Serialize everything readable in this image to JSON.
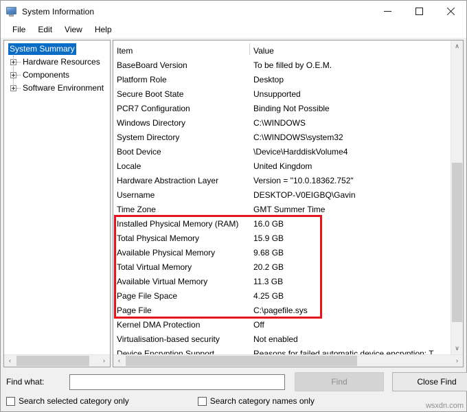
{
  "window": {
    "title": "System Information",
    "icon": "monitor-icon",
    "controls": {
      "minimize": "–",
      "maximize": "□",
      "close": "✕"
    }
  },
  "menubar": {
    "items": [
      "File",
      "Edit",
      "View",
      "Help"
    ]
  },
  "tree": {
    "root": {
      "label": "System Summary",
      "selected": true
    },
    "nodes": [
      {
        "label": "Hardware Resources",
        "expander": "plus-icon"
      },
      {
        "label": "Components",
        "expander": "plus-icon"
      },
      {
        "label": "Software Environment",
        "expander": "plus-icon"
      }
    ]
  },
  "table": {
    "columns": [
      "Item",
      "Value"
    ],
    "rows": [
      {
        "item": "BaseBoard Version",
        "value": "To be filled by O.E.M."
      },
      {
        "item": "Platform Role",
        "value": "Desktop"
      },
      {
        "item": "Secure Boot State",
        "value": "Unsupported"
      },
      {
        "item": "PCR7 Configuration",
        "value": "Binding Not Possible"
      },
      {
        "item": "Windows Directory",
        "value": "C:\\WINDOWS"
      },
      {
        "item": "System Directory",
        "value": "C:\\WINDOWS\\system32"
      },
      {
        "item": "Boot Device",
        "value": "\\Device\\HarddiskVolume4"
      },
      {
        "item": "Locale",
        "value": "United Kingdom"
      },
      {
        "item": "Hardware Abstraction Layer",
        "value": "Version = \"10.0.18362.752\""
      },
      {
        "item": "Username",
        "value": "DESKTOP-V0EIGBQ\\Gavin"
      },
      {
        "item": "Time Zone",
        "value": "GMT Summer Time"
      },
      {
        "item": "Installed Physical Memory (RAM)",
        "value": "16.0 GB"
      },
      {
        "item": "Total Physical Memory",
        "value": "15.9 GB"
      },
      {
        "item": "Available Physical Memory",
        "value": "9.68 GB"
      },
      {
        "item": "Total Virtual Memory",
        "value": "20.2 GB"
      },
      {
        "item": "Available Virtual Memory",
        "value": "11.3 GB"
      },
      {
        "item": "Page File Space",
        "value": "4.25 GB"
      },
      {
        "item": "Page File",
        "value": "C:\\pagefile.sys"
      },
      {
        "item": "Kernel DMA Protection",
        "value": "Off"
      },
      {
        "item": "Virtualisation-based security",
        "value": "Not enabled"
      },
      {
        "item": "Device Encryption Support",
        "value": "Reasons for failed automatic device encryption: T"
      }
    ]
  },
  "annotation": {
    "highlight_color": "#e8131a",
    "first_row_index": 11,
    "last_row_index": 17
  },
  "scrollbars": {
    "up_arrow": "∧",
    "down_arrow": "∨",
    "left_arrow": "‹",
    "right_arrow": "›"
  },
  "findbar": {
    "label": "Find what:",
    "input_value": "",
    "input_placeholder": "",
    "find_label": "Find",
    "find_enabled": false,
    "close_label": "Close Find",
    "checkbox_selected_category": {
      "label": "Search selected category only",
      "checked": false
    },
    "checkbox_category_names": {
      "label": "Search category names only",
      "checked": false
    }
  },
  "watermark": "wsxdn.com"
}
